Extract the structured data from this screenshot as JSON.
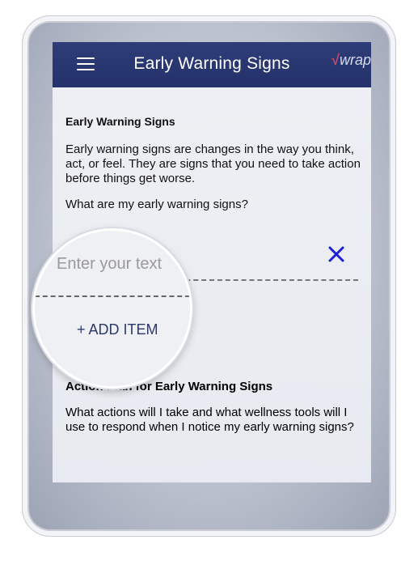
{
  "app": {
    "title": "Early Warning Signs",
    "logo_text": "wrap",
    "logo_mark": "√"
  },
  "sections": [
    {
      "title": "Early Warning Signs",
      "description": "Early warning signs are changes in the way you think, act, or feel. They are signs that you need to take action before things get worse.",
      "question": "What are my early warning signs?",
      "input": {
        "value": "",
        "placeholder": "Enter your text"
      },
      "add_button": "+ ADD ITEM"
    },
    {
      "title": "Action Plan for Early Warning Signs",
      "description": "What actions will I take and what wellness tools will I use to respond when I notice my early warning signs?"
    }
  ],
  "icons": [
    "menu-icon",
    "close-icon"
  ],
  "colors": {
    "appbar": "#2a3871",
    "clear_icon": "#1b1fd6",
    "add_item_text": "#2e3a66"
  }
}
